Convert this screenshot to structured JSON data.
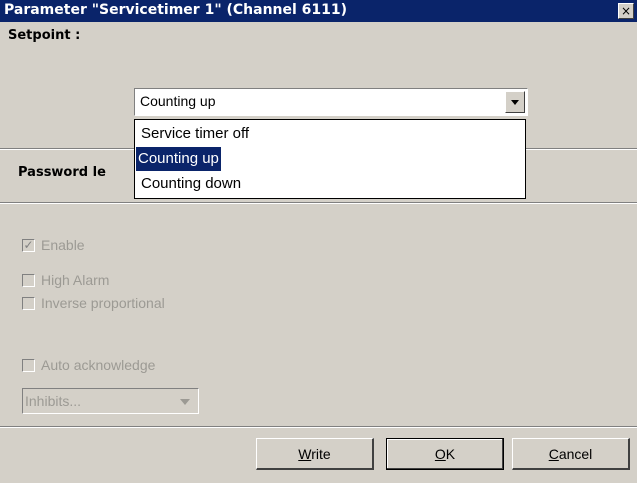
{
  "window": {
    "title": "Parameter \"Servicetimer 1\" (Channel 6111)",
    "close_glyph": "×"
  },
  "setpoint": {
    "label": "Setpoint :",
    "selected": "Counting up",
    "options": [
      "Service timer off",
      "Counting up",
      "Counting down"
    ],
    "highlighted_index": 1
  },
  "password": {
    "label_visible": "Password le"
  },
  "checks": [
    {
      "label": "Enable",
      "checked": true
    },
    {
      "label": "High Alarm",
      "checked": false
    },
    {
      "label": "Inverse proportional",
      "checked": false
    },
    {
      "label": "Auto acknowledge",
      "checked": false
    }
  ],
  "inhibits": {
    "value": "Inhibits..."
  },
  "buttons": {
    "write_prefix": "W",
    "write_rest": "rite",
    "ok_prefix": "O",
    "ok_rest": "K",
    "cancel_prefix": "C",
    "cancel_rest": "ancel"
  },
  "colors": {
    "titlebar": "#0a246a",
    "dialog_bg": "#d4d0c8",
    "selection": "#0a246a",
    "disabled_text": "#9c9a94"
  }
}
